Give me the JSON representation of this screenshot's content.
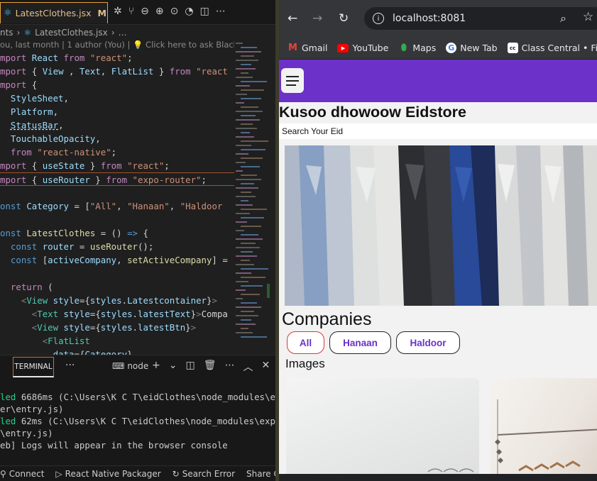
{
  "vscode": {
    "tab": {
      "filename": "LatestClothes.jsx",
      "modified": "M",
      "close": "×"
    },
    "breadcrumb": {
      "prefix": "nts",
      "sep": "›",
      "file": "LatestClothes.jsx",
      "more": "…"
    },
    "blame": {
      "text": "ou, last month | 1 author (You) |",
      "ask": "Click here to ask Blackbox"
    },
    "code": [
      {
        "parts": [
          [
            "kw",
            "mport "
          ],
          [
            "id",
            "React "
          ],
          [
            "kw",
            "from "
          ],
          [
            "str",
            "\"react\""
          ],
          [
            "",
            "; "
          ]
        ]
      },
      {
        "parts": [
          [
            "kw",
            "mport "
          ],
          [
            "",
            "{ "
          ],
          [
            "id",
            "View"
          ],
          [
            "",
            " , "
          ],
          [
            "id",
            "Text"
          ],
          [
            "",
            ", "
          ],
          [
            "id",
            "FlatList"
          ],
          [
            "",
            " } "
          ],
          [
            "kw",
            "from "
          ],
          [
            "str",
            "\"react"
          ]
        ]
      },
      {
        "parts": [
          [
            "kw",
            "mport "
          ],
          [
            "",
            "{"
          ]
        ]
      },
      {
        "parts": [
          [
            "",
            "  "
          ],
          [
            "id",
            "StyleSheet"
          ],
          [
            "",
            ","
          ]
        ]
      },
      {
        "parts": [
          [
            "",
            "  "
          ],
          [
            "id",
            "Platform"
          ],
          [
            "",
            ","
          ]
        ]
      },
      {
        "parts": [
          [
            "",
            "  "
          ],
          [
            "id",
            "StatusBar"
          ],
          [
            "",
            ","
          ]
        ]
      },
      {
        "parts": [
          [
            "",
            "  "
          ],
          [
            "id",
            "TouchableOpacity"
          ],
          [
            "",
            ","
          ]
        ]
      },
      {
        "parts": [
          [
            "",
            "  "
          ],
          [
            "kw",
            "from "
          ],
          [
            "str",
            "\"react-native\""
          ],
          [
            "",
            ";"
          ]
        ]
      },
      {
        "parts": [
          [
            "kw",
            "mport "
          ],
          [
            "",
            "{ "
          ],
          [
            "id",
            "useState"
          ],
          [
            "",
            " } "
          ],
          [
            "kw",
            "from "
          ],
          [
            "str",
            "\"react\""
          ],
          [
            "",
            ";"
          ]
        ]
      },
      {
        "parts": [
          [
            "kw",
            "mport "
          ],
          [
            "",
            "{ "
          ],
          [
            "id",
            "useRouter"
          ],
          [
            "",
            " } "
          ],
          [
            "kw",
            "from "
          ],
          [
            "str",
            "\"expo-router\""
          ],
          [
            "",
            ";"
          ]
        ]
      },
      {
        "parts": [
          [
            "",
            ""
          ]
        ]
      },
      {
        "parts": [
          [
            "kb",
            "onst "
          ],
          [
            "id",
            "Category "
          ],
          [
            "",
            "= ["
          ],
          [
            "str",
            "\"All\""
          ],
          [
            "",
            ", "
          ],
          [
            "str",
            "\"Hanaan\""
          ],
          [
            "",
            ", "
          ],
          [
            "str",
            "\"Haldoor"
          ]
        ]
      },
      {
        "parts": [
          [
            "",
            ""
          ]
        ]
      },
      {
        "parts": [
          [
            "kb",
            "onst "
          ],
          [
            "fn",
            "LatestClothes "
          ],
          [
            "",
            "= () "
          ],
          [
            "kb",
            "=> "
          ],
          [
            "",
            "{"
          ]
        ]
      },
      {
        "parts": [
          [
            "",
            "  "
          ],
          [
            "kb",
            "const "
          ],
          [
            "id",
            "router "
          ],
          [
            "",
            "= "
          ],
          [
            "fn",
            "useRouter"
          ],
          [
            "",
            "();"
          ]
        ]
      },
      {
        "parts": [
          [
            "",
            "  "
          ],
          [
            "kb",
            "const "
          ],
          [
            "",
            "["
          ],
          [
            "id",
            "activeCompany"
          ],
          [
            "",
            ", "
          ],
          [
            "fn",
            "setActiveCompany"
          ],
          [
            "",
            "] ="
          ]
        ]
      },
      {
        "parts": [
          [
            "",
            ""
          ]
        ]
      },
      {
        "parts": [
          [
            "",
            "  "
          ],
          [
            "kw",
            "return "
          ],
          [
            "",
            "("
          ]
        ]
      },
      {
        "parts": [
          [
            "",
            "    "
          ],
          [
            "tag",
            "<"
          ],
          [
            "cls",
            "View "
          ],
          [
            "id",
            "style"
          ],
          [
            "",
            "={"
          ],
          [
            "id",
            "styles"
          ],
          [
            "",
            "."
          ],
          [
            "id",
            "Latestcontainer"
          ],
          [
            "",
            "}"
          ],
          [
            "tag",
            ">"
          ]
        ]
      },
      {
        "parts": [
          [
            "",
            "      "
          ],
          [
            "tag",
            "<"
          ],
          [
            "cls",
            "Text "
          ],
          [
            "id",
            "style"
          ],
          [
            "",
            "={"
          ],
          [
            "id",
            "styles"
          ],
          [
            "",
            "."
          ],
          [
            "id",
            "latestText"
          ],
          [
            "",
            "}"
          ],
          [
            "tag",
            ">"
          ],
          [
            "",
            "Compa"
          ]
        ]
      },
      {
        "parts": [
          [
            "",
            "      "
          ],
          [
            "tag",
            "<"
          ],
          [
            "cls",
            "View "
          ],
          [
            "id",
            "style"
          ],
          [
            "",
            "={"
          ],
          [
            "id",
            "styles"
          ],
          [
            "",
            "."
          ],
          [
            "id",
            "latestBtn"
          ],
          [
            "",
            "}"
          ],
          [
            "tag",
            ">"
          ]
        ]
      },
      {
        "parts": [
          [
            "",
            "        "
          ],
          [
            "tag",
            "<"
          ],
          [
            "cls",
            "FlatList"
          ]
        ]
      },
      {
        "parts": [
          [
            "",
            "          "
          ],
          [
            "id",
            "data"
          ],
          [
            "",
            "={"
          ],
          [
            "id",
            "Category"
          ],
          [
            "",
            "}"
          ]
        ]
      }
    ],
    "panel": {
      "tab": "TERMINAL",
      "more": "···",
      "shell": "node",
      "lines": [
        [
          [
            "grn",
            "led "
          ],
          [
            "",
            "6686ms (C:\\Users\\K C T\\eidClothes\\node_modules\\e"
          ]
        ],
        [
          [
            "",
            "er\\entry.js)"
          ]
        ],
        [
          [
            "grn",
            "led "
          ],
          [
            "",
            "62ms (C:\\Users\\K C T\\eidClothes\\node_modules\\exp"
          ]
        ],
        [
          [
            "",
            "\\entry.js)"
          ]
        ],
        [
          [
            "",
            "eb] Logs will appear in the browser console"
          ]
        ]
      ]
    },
    "statusbar": [
      "Connect",
      "React Native Packager",
      "Search Error",
      "Share Cod"
    ]
  },
  "browser": {
    "url": "localhost:8081",
    "bookmarks": [
      {
        "label": "Gmail",
        "icon": "gmail-icon"
      },
      {
        "label": "YouTube",
        "icon": "youtube-icon"
      },
      {
        "label": "Maps",
        "icon": "maps-icon"
      },
      {
        "label": "New Tab",
        "icon": "google-icon"
      },
      {
        "label": "Class Central • Find...",
        "icon": "class-central-icon"
      }
    ],
    "page": {
      "title": "Kusoo dhowoow Eidstore",
      "search_placeholder": "Search Your Eid",
      "companies_heading": "Companies",
      "chips": [
        "All",
        "Hanaan",
        "Haldoor"
      ],
      "active_chip": "All",
      "images_heading": "Images",
      "accent": "#6b31c9"
    }
  }
}
